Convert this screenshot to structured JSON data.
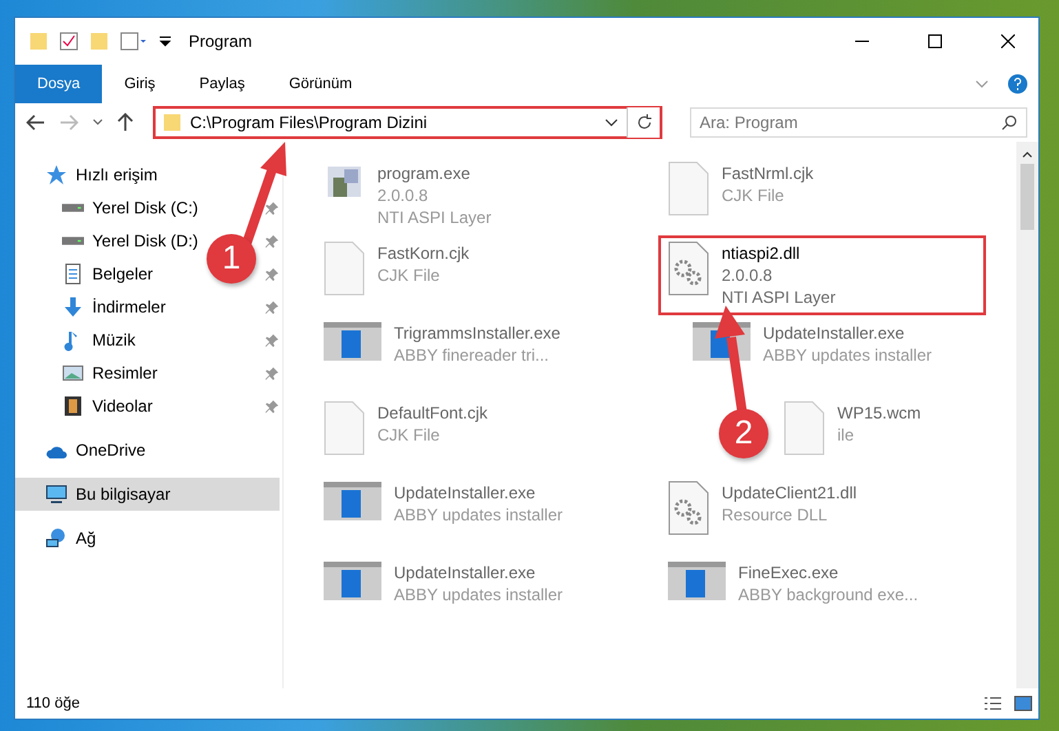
{
  "window": {
    "title": "Program"
  },
  "ribbon_tabs": [
    {
      "label": "Dosya",
      "selected": true
    },
    {
      "label": "Giriş",
      "selected": false
    },
    {
      "label": "Paylaş",
      "selected": false
    },
    {
      "label": "Görünüm",
      "selected": false
    }
  ],
  "address": {
    "path": "C:\\Program Files\\Program Dizini",
    "highlighted": true
  },
  "search": {
    "placeholder": "Ara: Program"
  },
  "sidebar": {
    "items": [
      {
        "label": "Hızlı erişim",
        "kind": "star",
        "selected": false,
        "children": [
          {
            "label": "Yerel Disk (C:)",
            "kind": "disk",
            "selected": false,
            "pinned": true
          },
          {
            "label": "Yerel Disk (D:)",
            "kind": "disk",
            "selected": false,
            "pinned": true
          },
          {
            "label": "Belgeler",
            "kind": "docs",
            "selected": false,
            "pinned": true
          },
          {
            "label": "İndirmeler",
            "kind": "download",
            "selected": false,
            "pinned": true
          },
          {
            "label": "Müzik",
            "kind": "music",
            "selected": false,
            "pinned": true
          },
          {
            "label": "Resimler",
            "kind": "pictures",
            "selected": false,
            "pinned": true
          },
          {
            "label": "Videolar",
            "kind": "video",
            "selected": false,
            "pinned": true
          }
        ]
      },
      {
        "label": "OneDrive",
        "kind": "cloud",
        "selected": false
      },
      {
        "label": "Bu bilgisayar",
        "kind": "computer",
        "selected": true
      },
      {
        "label": "Ağ",
        "kind": "network",
        "selected": false
      }
    ]
  },
  "files": [
    {
      "name": "program.exe",
      "lines": [
        "2.0.0.8",
        "NTI ASPI Layer"
      ],
      "kind": "program",
      "blurred": true
    },
    {
      "name": "FastNrml.cjk",
      "lines": [
        "CJK File"
      ],
      "kind": "document",
      "blurred": true
    },
    {
      "name": "FastKorn.cjk",
      "lines": [
        "CJK File"
      ],
      "kind": "document",
      "blurred": true
    },
    {
      "name": "ntiaspi2.dll",
      "lines": [
        "2.0.0.8",
        "NTI ASPI Layer"
      ],
      "kind": "dll",
      "blurred": false,
      "highlighted": true
    },
    {
      "name": "TrigrammsInstaller.exe",
      "lines": [
        "ABBY finereader tri..."
      ],
      "kind": "installer",
      "blurred": true
    },
    {
      "name": "UpdateInstaller.exe",
      "lines": [
        "ABBY updates installer"
      ],
      "kind": "installer",
      "blurred": true
    },
    {
      "name": "DefaultFont.cjk",
      "lines": [
        "CJK File"
      ],
      "kind": "document",
      "blurred": true
    },
    {
      "name": "WP15.wcm",
      "lines": [
        "ile"
      ],
      "kind": "document",
      "blurred": true
    },
    {
      "name": "UpdateInstaller.exe",
      "lines": [
        "ABBY updates installer"
      ],
      "kind": "installer",
      "blurred": true
    },
    {
      "name": "UpdateClient21.dll",
      "lines": [
        "Resource DLL"
      ],
      "kind": "dll",
      "blurred": true
    },
    {
      "name": "UpdateInstaller.exe",
      "lines": [
        "ABBY updates installer"
      ],
      "kind": "installer",
      "blurred": true
    },
    {
      "name": "FineExec.exe",
      "lines": [
        "ABBY background exe..."
      ],
      "kind": "installer",
      "blurred": true
    }
  ],
  "status_bar": {
    "count": "110 öğe"
  },
  "annotations": [
    {
      "label": "1"
    },
    {
      "label": "2"
    }
  ]
}
